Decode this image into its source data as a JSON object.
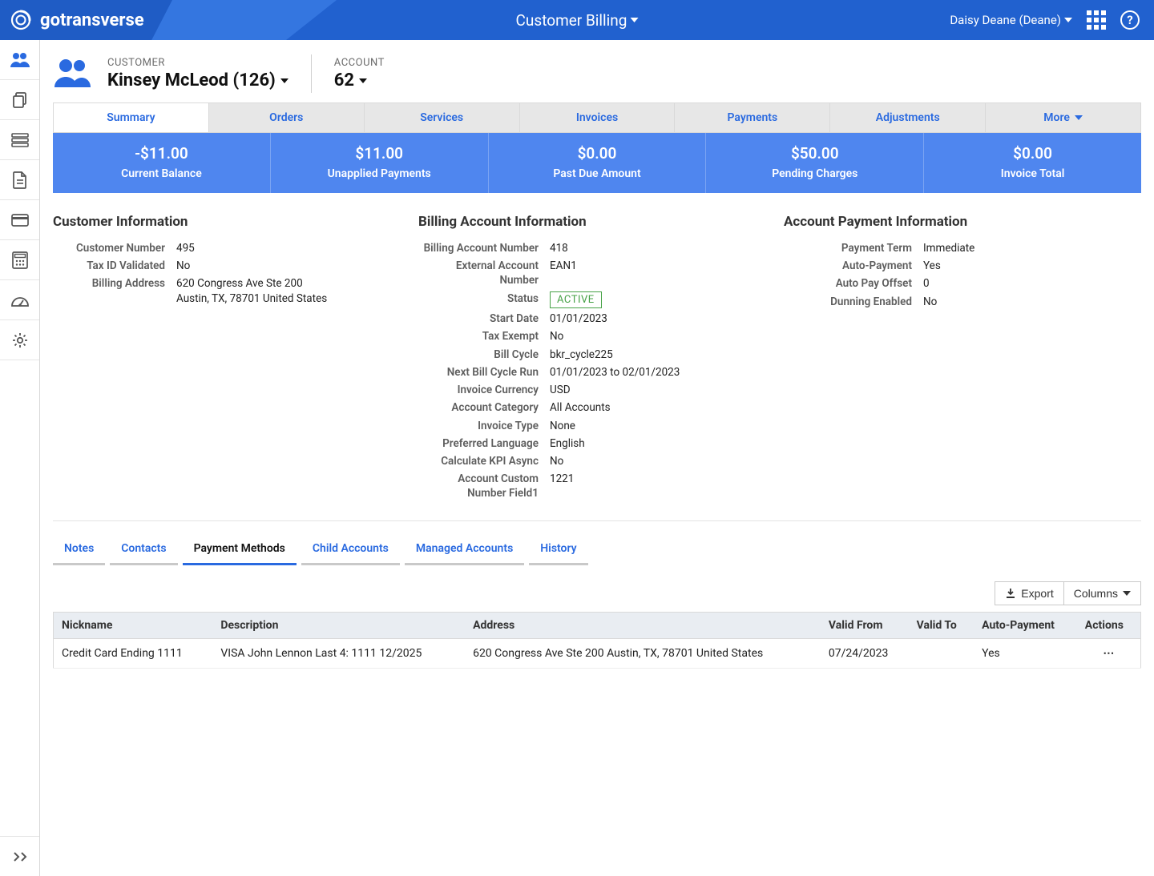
{
  "brand": "gotransverse",
  "page_title": "Customer Billing",
  "user_name": "Daisy Deane (Deane)",
  "header": {
    "customer_label": "CUSTOMER",
    "customer_name": "Kinsey McLeod (126)",
    "account_label": "ACCOUNT",
    "account_value": "62"
  },
  "navtabs": [
    "Summary",
    "Orders",
    "Services",
    "Invoices",
    "Payments",
    "Adjustments"
  ],
  "navtabs_more": "More",
  "stats": [
    {
      "value": "-$11.00",
      "label": "Current Balance"
    },
    {
      "value": "$11.00",
      "label": "Unapplied Payments"
    },
    {
      "value": "$0.00",
      "label": "Past Due Amount"
    },
    {
      "value": "$50.00",
      "label": "Pending Charges"
    },
    {
      "value": "$0.00",
      "label": "Invoice Total"
    }
  ],
  "customer_info_title": "Customer Information",
  "customer_info": {
    "Customer Number": "495",
    "Tax ID Validated": "No",
    "Billing Address": "620 Congress Ave Ste 200\nAustin, TX, 78701 United States"
  },
  "billing_info_title": "Billing Account Information",
  "billing_info": [
    {
      "k": "Billing Account Number",
      "v": "418"
    },
    {
      "k": "External Account Number",
      "v": "EAN1"
    },
    {
      "k": "Status",
      "v": "ACTIVE",
      "badge": true
    },
    {
      "k": "Start Date",
      "v": "01/01/2023"
    },
    {
      "k": "Tax Exempt",
      "v": "No"
    },
    {
      "k": "Bill Cycle",
      "v": "bkr_cycle225"
    },
    {
      "k": "Next Bill Cycle Run",
      "v": "01/01/2023 to 02/01/2023"
    },
    {
      "k": "Invoice Currency",
      "v": "USD"
    },
    {
      "k": "Account Category",
      "v": "All Accounts"
    },
    {
      "k": "Invoice Type",
      "v": "None"
    },
    {
      "k": "Preferred Language",
      "v": "English"
    },
    {
      "k": "Calculate KPI Async",
      "v": "No"
    },
    {
      "k": "Account Custom Number Field1",
      "v": "1221"
    }
  ],
  "payment_info_title": "Account Payment Information",
  "payment_info": [
    {
      "k": "Payment Term",
      "v": "Immediate"
    },
    {
      "k": "Auto-Payment",
      "v": "Yes"
    },
    {
      "k": "Auto Pay Offset",
      "v": "0"
    },
    {
      "k": "Dunning Enabled",
      "v": "No"
    }
  ],
  "subtabs": [
    "Notes",
    "Contacts",
    "Payment Methods",
    "Child Accounts",
    "Managed Accounts",
    "History"
  ],
  "subtabs_active": "Payment Methods",
  "toolbar": {
    "export": "Export",
    "columns": "Columns"
  },
  "table": {
    "headers": [
      "Nickname",
      "Description",
      "Address",
      "Valid From",
      "Valid To",
      "Auto-Payment",
      "Actions"
    ],
    "rows": [
      {
        "nickname": "Credit Card Ending 1111",
        "description": "VISA John Lennon Last 4: 1111 12/2025",
        "address": "620 Congress Ave Ste 200 Austin, TX, 78701 United States",
        "valid_from": "07/24/2023",
        "valid_to": "",
        "auto_payment": "Yes"
      }
    ]
  }
}
